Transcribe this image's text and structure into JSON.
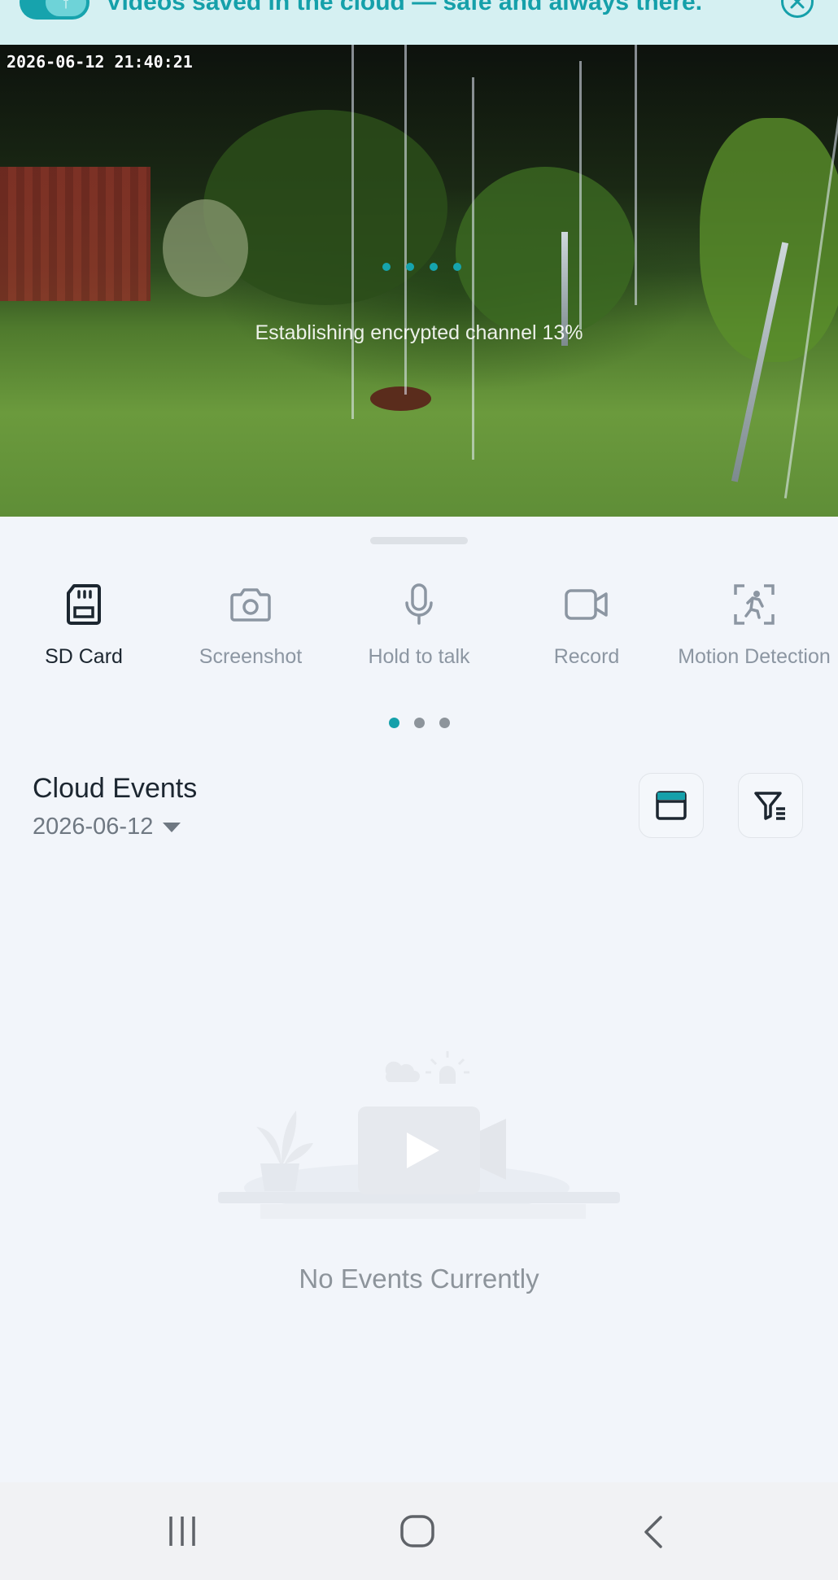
{
  "banner": {
    "text": "Videos saved in the cloud — safe and always there."
  },
  "feed": {
    "timestamp": "2026-06-12 21:40:21",
    "status": "Establishing encrypted channel 13%",
    "progress_percent": 13
  },
  "controls": [
    {
      "label": "SD Card",
      "icon": "sd-card-icon",
      "active": true
    },
    {
      "label": "Screenshot",
      "icon": "camera-icon",
      "active": false
    },
    {
      "label": "Hold to talk",
      "icon": "microphone-icon",
      "active": false
    },
    {
      "label": "Record",
      "icon": "video-camera-icon",
      "active": false
    },
    {
      "label": "Motion Detection",
      "icon": "motion-detection-icon",
      "active": false
    }
  ],
  "pager": {
    "pages": 3,
    "current": 1
  },
  "cloud_events": {
    "title": "Cloud Events",
    "date": "2026-06-12",
    "empty_text": "No Events Currently"
  },
  "colors": {
    "accent": "#15a0aa",
    "background": "#f2f5fa",
    "banner_bg": "#d5f0f2"
  }
}
